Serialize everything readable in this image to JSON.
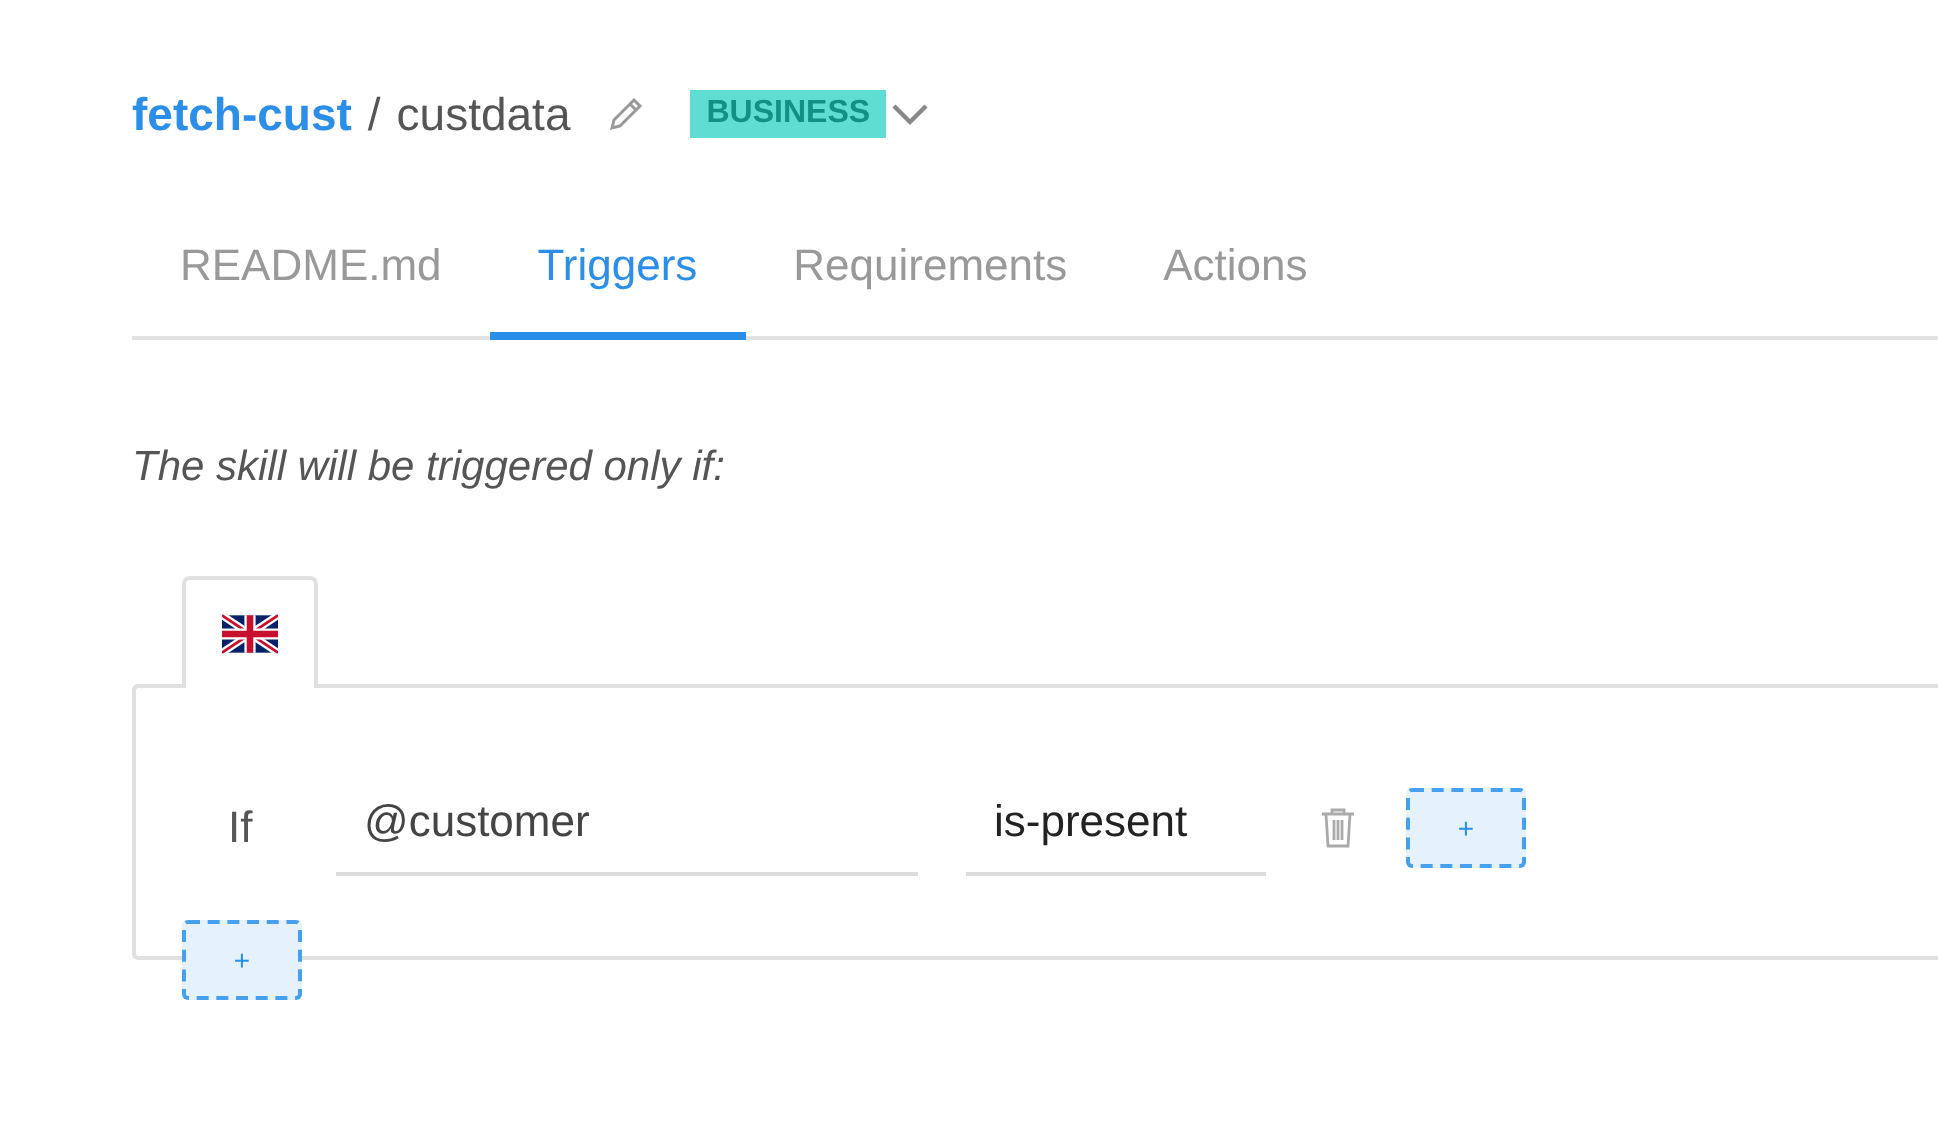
{
  "header": {
    "project": "fetch-cust",
    "separator": "/",
    "name": "custdata",
    "badge": "BUSINESS"
  },
  "tabs": [
    {
      "label": "README.md",
      "selected": false
    },
    {
      "label": "Triggers",
      "selected": true
    },
    {
      "label": "Requirements",
      "selected": false
    },
    {
      "label": "Actions",
      "selected": false
    }
  ],
  "intro": "The skill will be triggered only if:",
  "language_tabs": [
    {
      "kind": "uk-flag",
      "selected": true
    }
  ],
  "condition": {
    "keyword": "If",
    "entity": "@customer",
    "operator": "is-present",
    "add_label": "+"
  },
  "add_condition_label": "+"
}
